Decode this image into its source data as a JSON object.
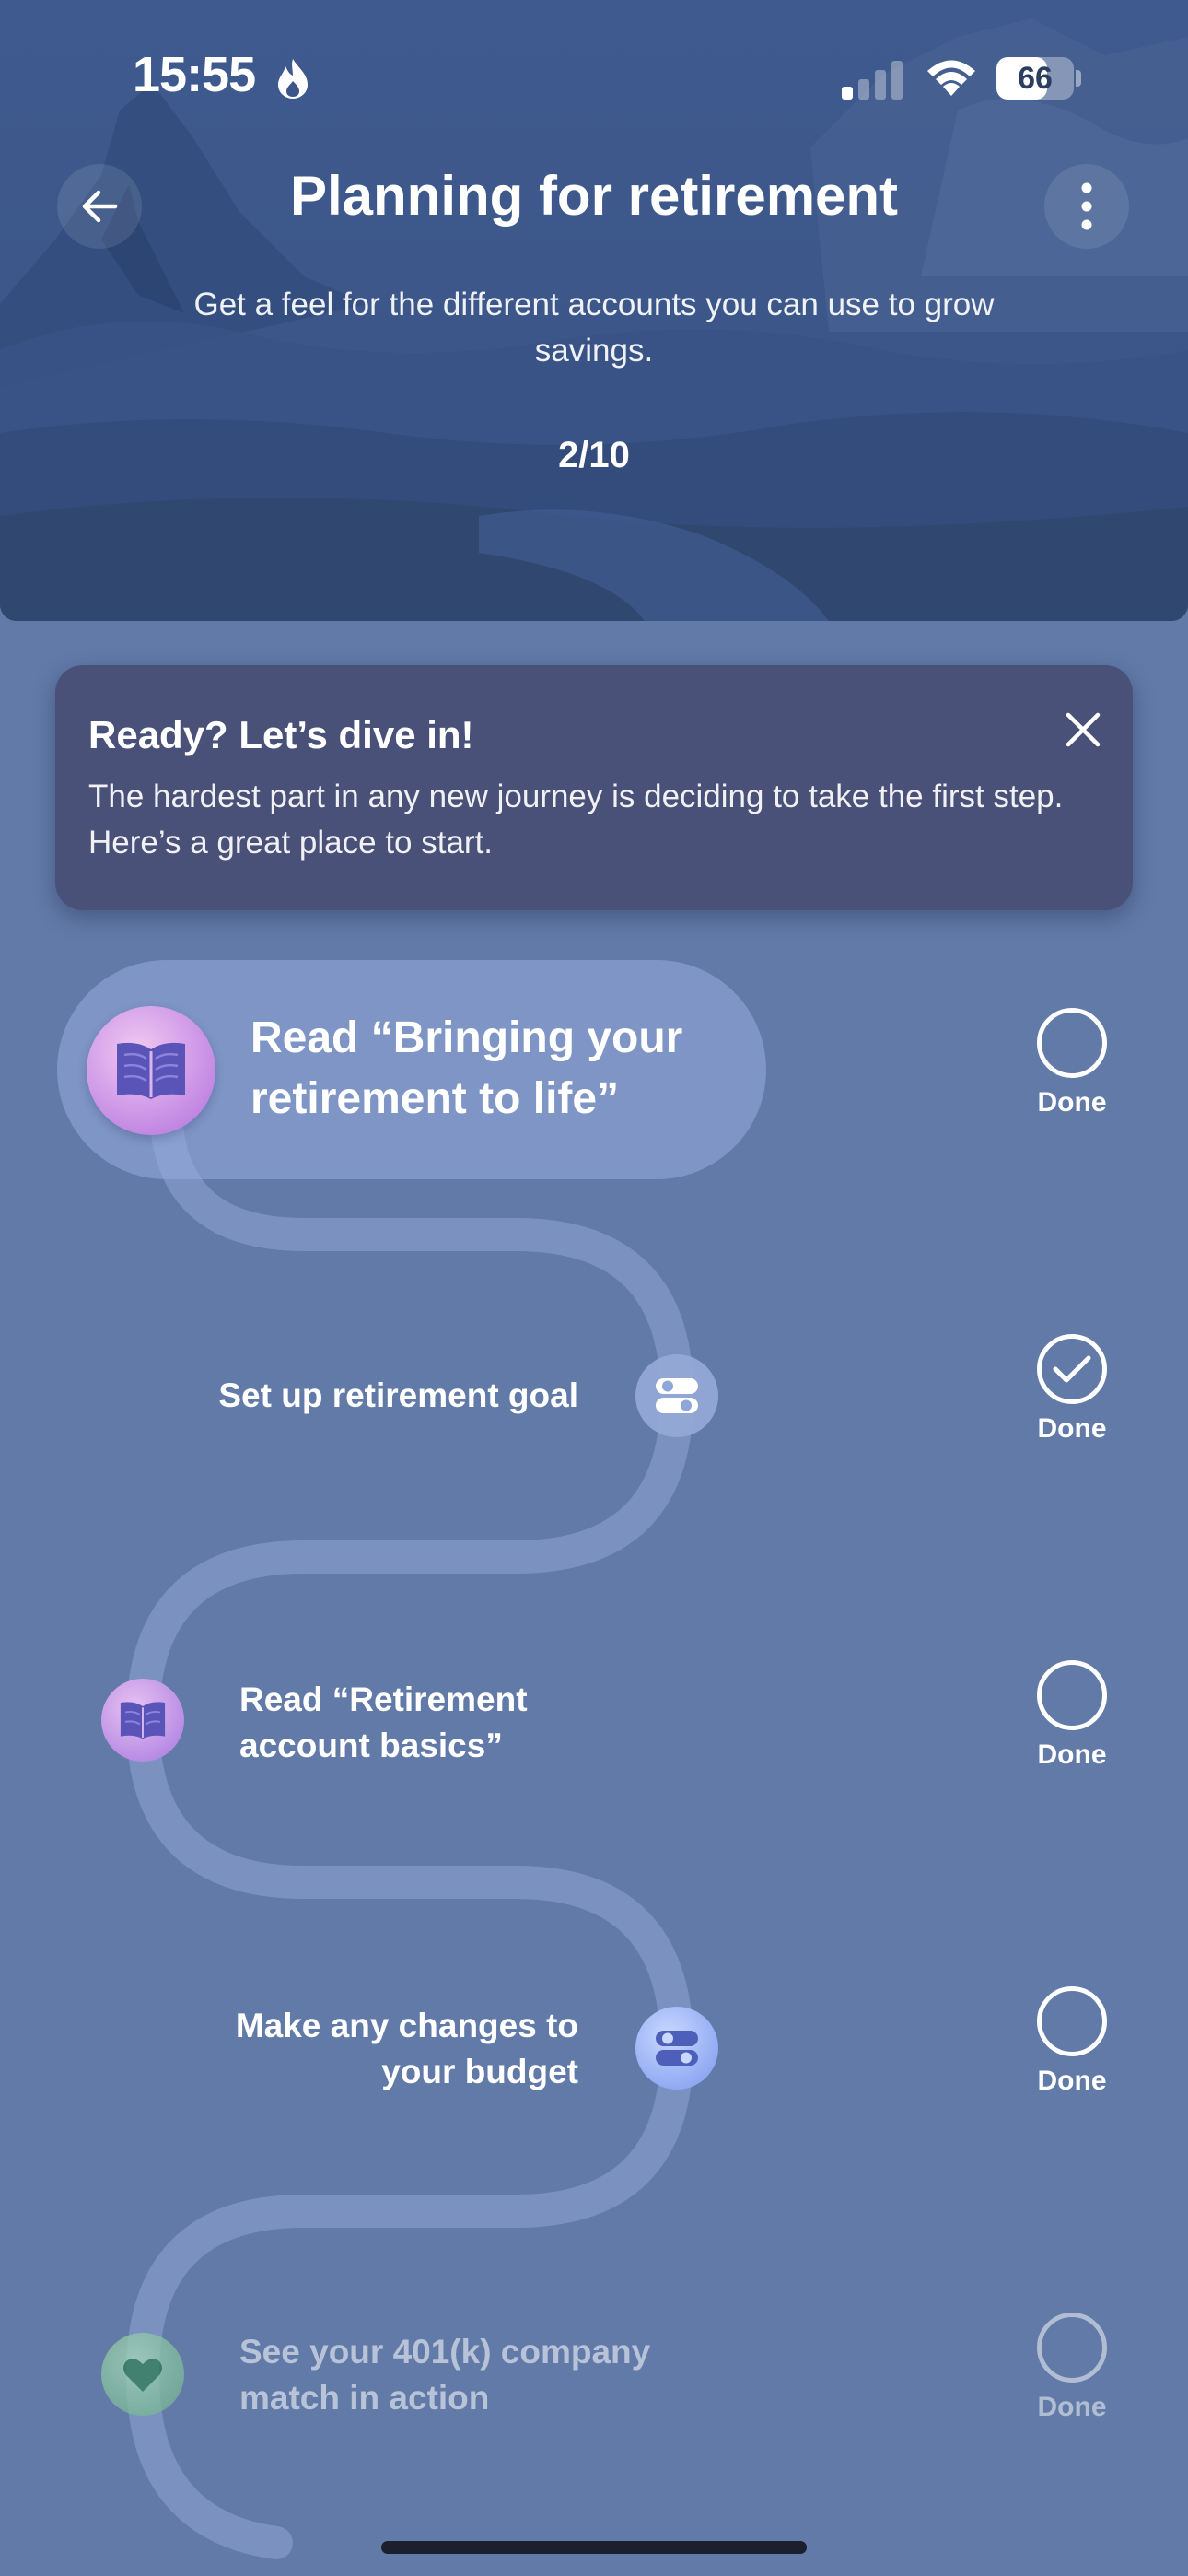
{
  "status_bar": {
    "time": "15:55",
    "battery_percent": "66",
    "battery_level": 0.66,
    "icons": [
      "flame-icon",
      "signal-icon",
      "wifi-icon",
      "battery-icon"
    ]
  },
  "header": {
    "title": "Planning for retirement",
    "subtitle": "Get a feel for the different accounts you can use to grow savings.",
    "progress": "2/10",
    "back_icon": "arrow-left-icon",
    "more_icon": "vertical-dots-icon"
  },
  "banner": {
    "title": "Ready? Let’s dive in!",
    "text": "The hardest part in any new journey is deciding to take the first step. Here’s a great place to start.",
    "close_icon": "close-icon"
  },
  "steps": [
    {
      "label": "Read “Bringing your retirement to life”",
      "icon": "book-icon",
      "done_label": "Done",
      "done": false
    },
    {
      "label": "Set up retirement goal",
      "icon": "toggle-icon",
      "done_label": "Done",
      "done": true
    },
    {
      "label": "Read “Retirement account basics”",
      "icon": "book-icon",
      "done_label": "Done",
      "done": false
    },
    {
      "label": "Make any changes to your budget",
      "icon": "toggle-icon",
      "done_label": "Done",
      "done": false
    },
    {
      "label": "See your 401(k) company match in action",
      "icon": "heart-icon",
      "done_label": "Done",
      "done": false
    }
  ],
  "colors": {
    "background": "#627aa8",
    "header": "#3f5a8e",
    "banner": "#4a5178"
  }
}
